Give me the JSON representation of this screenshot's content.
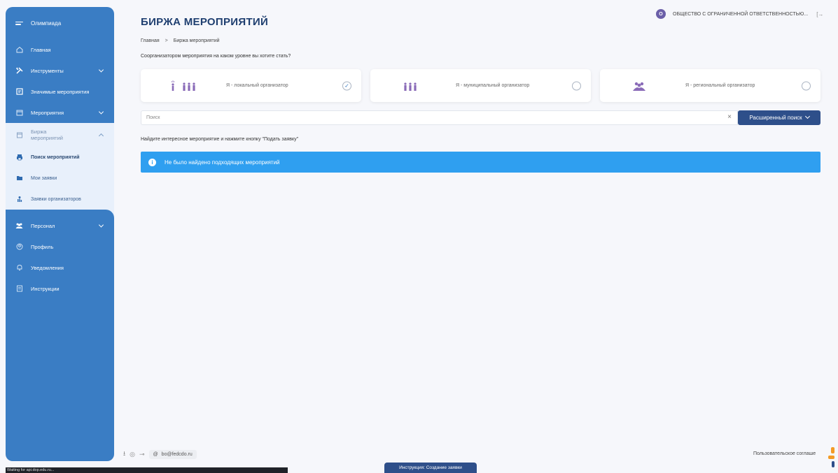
{
  "sidebar": {
    "title": "Олимпиада",
    "items": [
      {
        "label": "Главная",
        "icon": "home-icon"
      },
      {
        "label": "Инструменты",
        "icon": "tools-icon"
      },
      {
        "label": "Значимые мероприятия",
        "icon": "star-list-icon"
      },
      {
        "label": "Мероприятия",
        "icon": "calendar-icon"
      }
    ],
    "exchange": {
      "label": "Биржа мероприятий",
      "children": [
        {
          "label": "Поиск мероприятий"
        },
        {
          "label": "Мои заявки"
        },
        {
          "label": "Заявки организаторов"
        }
      ]
    },
    "bottom_items": [
      {
        "label": "Персонал"
      },
      {
        "label": "Профиль"
      },
      {
        "label": "Уведомления"
      },
      {
        "label": "Инструкции"
      }
    ]
  },
  "header": {
    "title": "БИРЖА МЕРОПРИЯТИЙ",
    "breadcrumb": [
      "Главная",
      "Биржа мероприятий"
    ],
    "org_initial": "О",
    "org_name": "ОБЩЕСТВО С ОГРАНИЧЕННОЙ ОТВЕТСТВЕННОСТЬЮ..."
  },
  "question": "Соорганизатором мероприятия на каком уровне вы хотите стать?",
  "levels": [
    {
      "label": "Я - локальный организатор",
      "selected": true
    },
    {
      "label": "Я - муниципальный организатор",
      "selected": false
    },
    {
      "label": "Я - региональный организатор",
      "selected": false
    }
  ],
  "search": {
    "placeholder": "Поиск",
    "clear": "×",
    "advanced_label": "Расширенный поиск"
  },
  "hint": "Найдите интересное мероприятие и нажмите кнопку \"Подать заявку\"",
  "alert": "Не было найдено подходящих мероприятий",
  "footer": {
    "email": "bo@fedcdo.ru",
    "agreement": "Пользовательское соглаше"
  },
  "status_bar": "Waiting for api.dop.edu.ru...",
  "instruction_tab": "Инструкция: Создание заявки",
  "colors": {
    "sidebar": "#3a7dc4",
    "title": "#1f3f70",
    "primary_button": "#2e4f8a",
    "alert": "#2f9ff0",
    "figure": "#8a6bb8"
  }
}
